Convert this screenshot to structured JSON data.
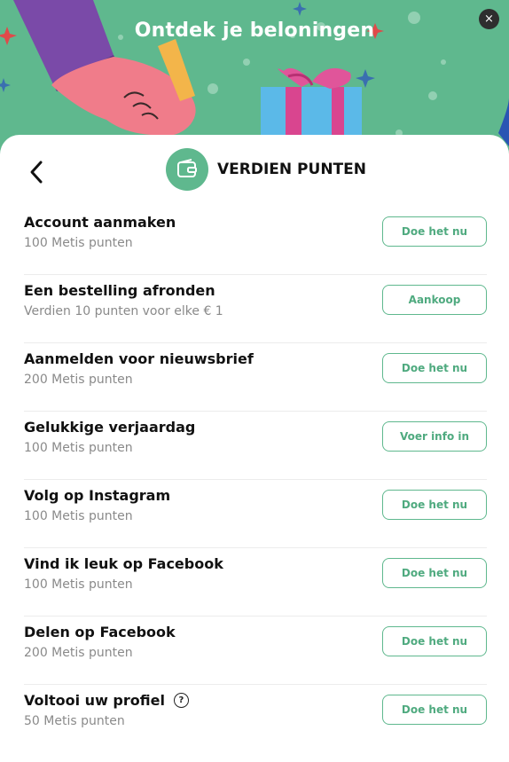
{
  "header": {
    "title": "Ontdek je beloningen",
    "close_label": "×"
  },
  "section": {
    "title": "VERDIEN PUNTEN"
  },
  "colors": {
    "accent": "#5fb88e",
    "hero_bg": "#5fb88e"
  },
  "items": [
    {
      "title": "Account aanmaken",
      "subtitle": "100 Metis punten",
      "button": "Doe het nu"
    },
    {
      "title": "Een bestelling afronden",
      "subtitle": "Verdien 10 punten voor elke € 1",
      "button": "Aankoop"
    },
    {
      "title": "Aanmelden voor nieuwsbrief",
      "subtitle": "200 Metis punten",
      "button": "Doe het nu"
    },
    {
      "title": "Gelukkige verjaardag",
      "subtitle": "100 Metis punten",
      "button": "Voer info in"
    },
    {
      "title": "Volg op Instagram",
      "subtitle": "100 Metis punten",
      "button": "Doe het nu"
    },
    {
      "title": "Vind ik leuk op Facebook",
      "subtitle": "100 Metis punten",
      "button": "Doe het nu"
    },
    {
      "title": "Delen op Facebook",
      "subtitle": "200 Metis punten",
      "button": "Doe het nu"
    },
    {
      "title": "Voltooi uw profiel",
      "subtitle": "50 Metis punten",
      "button": "Doe het nu",
      "help": "?"
    }
  ]
}
